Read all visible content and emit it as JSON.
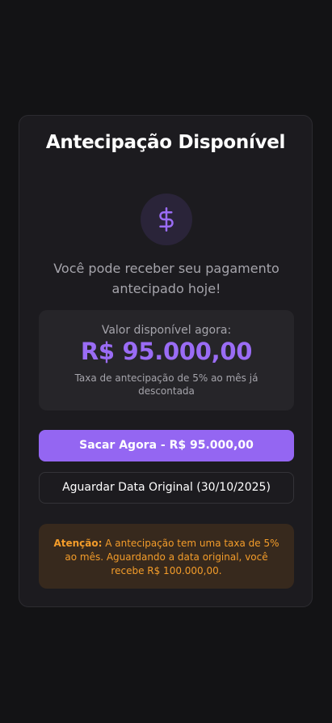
{
  "card": {
    "title": "Antecipação Disponível",
    "icon": "dollar-sign-icon",
    "subtitle": "Você pode receber seu pagamento antecipado hoje!"
  },
  "value_box": {
    "label": "Valor disponível agora:",
    "amount": "R$ 95.000,00",
    "note": "Taxa de antecipação de 5% ao mês já descontada"
  },
  "actions": {
    "withdraw_now_label": "Sacar Agora - R$ 95.000,00",
    "wait_original_label": "Aguardar Data Original (30/10/2025)"
  },
  "alert": {
    "prefix": "Atenção:",
    "message": " A antecipação tem uma taxa de 5% ao mês. Aguardando a data original, você recebe R$ 100.000,00."
  },
  "colors": {
    "background": "#131315",
    "card": "#1c1b1f",
    "accent": "#9466f2",
    "accent_text": "#9a6cf5",
    "warning_text": "#f39c2a",
    "warning_bg": "#37291d"
  }
}
